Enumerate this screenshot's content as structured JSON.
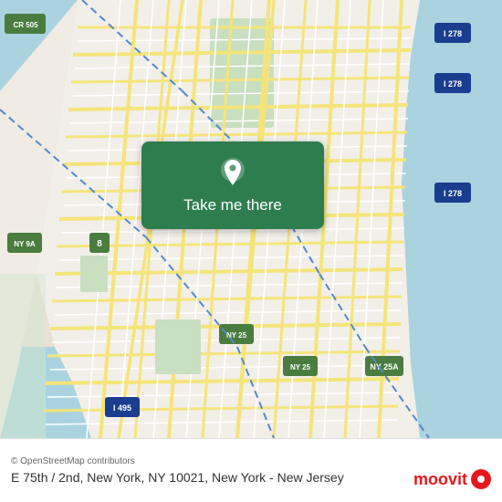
{
  "map": {
    "alt": "OpenStreetMap of Manhattan area showing E 75th / 2nd, New York",
    "attribution": "© OpenStreetMap contributors"
  },
  "button": {
    "label": "Take me there"
  },
  "location": {
    "address": "E 75th / 2nd, New York, NY 10021, New York - New Jersey"
  },
  "branding": {
    "name": "moovit"
  },
  "colors": {
    "button_green": "#2e7d4f",
    "moovit_red": "#e8171e",
    "map_water": "#aad3df",
    "map_land": "#f2efe9",
    "map_road_major": "#f5e47a",
    "map_road_minor": "#ffffff",
    "map_park": "#c8e6c0"
  }
}
